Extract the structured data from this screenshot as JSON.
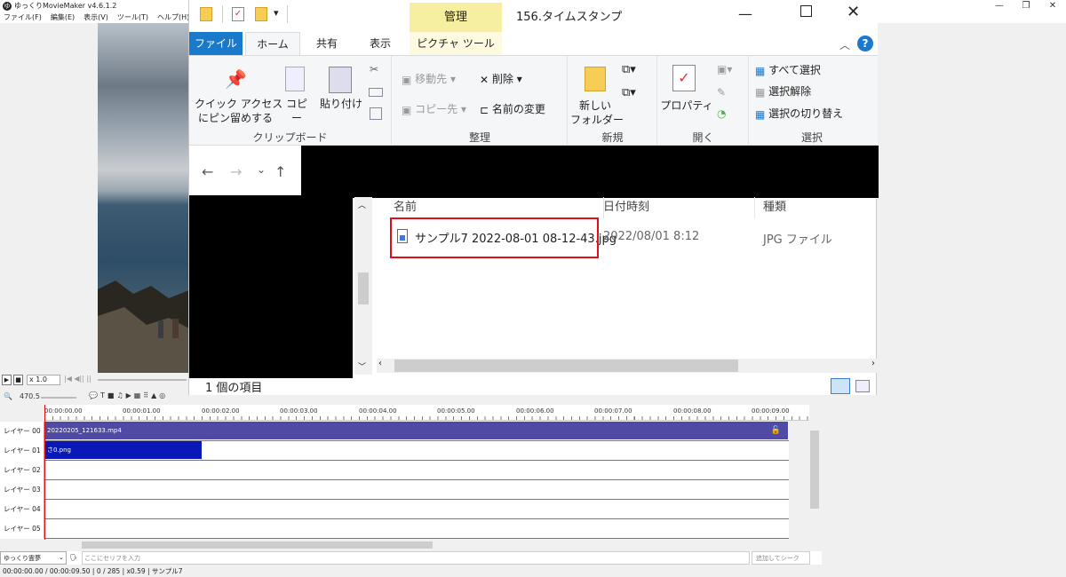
{
  "ymm": {
    "title": "ゆっくりMovieMaker v4.6.1.2",
    "menu": [
      "ファイル(F)",
      "編集(E)",
      "表示(V)",
      "ツール(T)",
      "ヘルプ(H)"
    ],
    "zoom_label": "x 1.0",
    "zoom_value": "470.5",
    "ruler": [
      "00:00:00.00",
      "00:00:01.00",
      "00:00:02.00",
      "00:00:03.00",
      "00:00:04.00",
      "00:00:05.00",
      "00:00:06.00",
      "00:00:07.00",
      "00:00:08.00",
      "00:00:09.00"
    ],
    "layers": [
      "レイヤー 00",
      "レイヤー 01",
      "レイヤー 02",
      "レイヤー 03",
      "レイヤー 04",
      "レイヤー 05"
    ],
    "clip0": "20220205_121633.mp4",
    "clip1": "さ0.png",
    "speaker": "ゆっくり霊夢",
    "serif_placeholder": "ここにセリフを入力",
    "add_button": "追加してシーク",
    "status": "00:00:00.00 / 00:00:09.50 | 0 / 285 | x0.59 | サンプル7"
  },
  "explorer": {
    "title": "156.タイムスタンプ",
    "context_tab": "管理",
    "tabs": [
      "ファイル",
      "ホーム",
      "共有",
      "表示",
      "ピクチャ ツール"
    ],
    "clipboard": {
      "pin": "クイック アクセス\nにピン留めする",
      "copy": "コピー",
      "paste": "貼り付け",
      "label": "クリップボード"
    },
    "organize": {
      "move": "移動先",
      "copyto": "コピー先",
      "delete": "削除",
      "rename": "名前の変更",
      "label": "整理"
    },
    "new": {
      "folder": "新しい\nフォルダー",
      "label": "新規"
    },
    "open": {
      "properties": "プロパティ",
      "label": "開く"
    },
    "select": {
      "all": "すべて選択",
      "none": "選択解除",
      "invert": "選択の切り替え",
      "label": "選択"
    },
    "columns": [
      "名前",
      "日付時刻",
      "種類"
    ],
    "file": {
      "name": "サンプル7 2022-08-01 08-12-43.jpg",
      "date": "2022/08/01 8:12",
      "type": "JPG ファイル"
    },
    "status": "1 個の項目"
  }
}
